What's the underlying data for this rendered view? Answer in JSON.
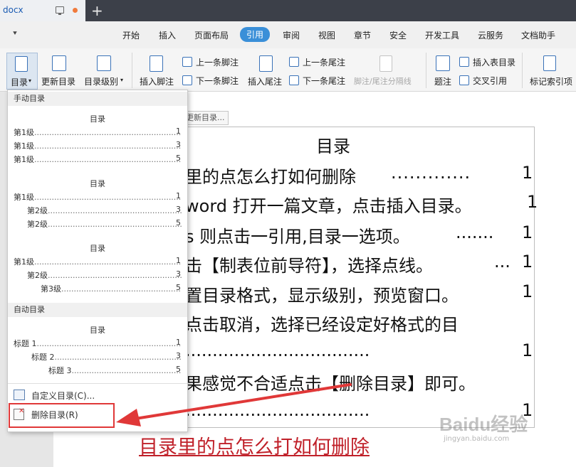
{
  "titlebar": {
    "doc_name": "docx",
    "plus": "+"
  },
  "menu": {
    "items": [
      "开始",
      "插入",
      "页面布局",
      "引用",
      "审阅",
      "视图",
      "章节",
      "安全",
      "开发工具",
      "云服务",
      "文档助手"
    ],
    "active": "引用"
  },
  "ribbon": {
    "toc": "目录",
    "update_toc": "更新目录",
    "toc_level": "目录级别",
    "insert_footnote": "插入脚注",
    "prev_footnote": "上一条脚注",
    "next_footnote": "下一条脚注",
    "insert_endnote": "插入尾注",
    "prev_endnote": "上一条尾注",
    "next_endnote": "下一条尾注",
    "footnote_sep": "脚注/尾注分隔线",
    "caption": "题注",
    "insert_table_of_contents": "插入表目录",
    "cross_ref": "交叉引用",
    "mark_index": "标记索引项"
  },
  "dropdown": {
    "manual_header": "手动目录",
    "auto_header": "自动目录",
    "block1": {
      "title": "目录",
      "rows": [
        {
          "label": "第1级",
          "page": "1"
        },
        {
          "label": "第1级",
          "page": "3"
        },
        {
          "label": "第1级",
          "page": "5"
        }
      ]
    },
    "block2": {
      "title": "目录",
      "rows": [
        {
          "label": "第1级",
          "page": "1"
        },
        {
          "label": "第2级",
          "page": "3"
        },
        {
          "label": "第2级",
          "page": "5"
        }
      ]
    },
    "block3": {
      "title": "目录",
      "rows": [
        {
          "label": "第1级",
          "page": "1"
        },
        {
          "label": "第2级",
          "page": "3"
        },
        {
          "label": "第3级",
          "page": "5"
        }
      ]
    },
    "block4": {
      "title": "目录",
      "rows": [
        {
          "label": "标题 1",
          "page": "1"
        },
        {
          "label": "标题 2",
          "page": "3"
        },
        {
          "label": "标题 3",
          "page": "5"
        }
      ]
    },
    "custom_toc": "自定义目录(C)...",
    "delete_toc": "删除目录(R)"
  },
  "document": {
    "update_tag": "更新目录...",
    "toc_title": "目录",
    "lines": [
      {
        "text": "里的点怎么打如何删除",
        "page": "1"
      },
      {
        "text": "word 打开一篇文章，点击插入目录。",
        "page": "1"
      },
      {
        "text": "s 则点击一引用,目录一选项。",
        "page": "1"
      },
      {
        "text": "击【制表位前导符】，选择点线。",
        "page": "1"
      },
      {
        "text": "置目录格式，显示级别，预览窗口。",
        "page": "1"
      },
      {
        "text": "点击取消，选择已经设定好格式的目",
        "page": ""
      },
      {
        "text": "",
        "page": "1"
      },
      {
        "text": "果感觉不合适点击【删除目录】即可。",
        "page": ""
      },
      {
        "text": "",
        "page": "1"
      }
    ],
    "bottom_title": "目录里的点怎么打如何删除"
  },
  "watermark": {
    "brand": "Baidu经验",
    "url": "jingyan.baidu.com"
  },
  "colors": {
    "accent": "#3a8fd8",
    "highlight": "#e03838",
    "red_title": "#c0212a"
  }
}
